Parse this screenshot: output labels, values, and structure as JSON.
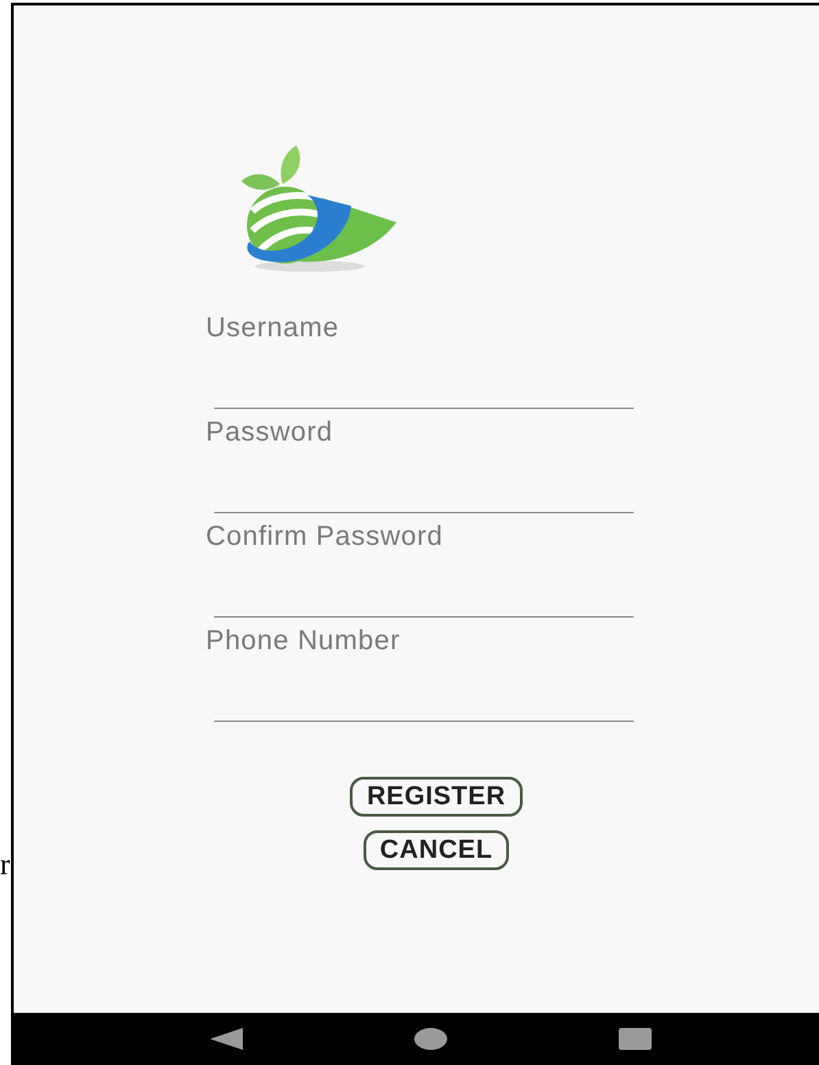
{
  "margin_text": "r",
  "form": {
    "fields": [
      {
        "placeholder": "Username"
      },
      {
        "placeholder": "Password"
      },
      {
        "placeholder": "Confirm Password"
      },
      {
        "placeholder": "Phone Number"
      }
    ],
    "buttons": [
      {
        "label": "REGISTER"
      },
      {
        "label": "CANCEL"
      }
    ]
  }
}
